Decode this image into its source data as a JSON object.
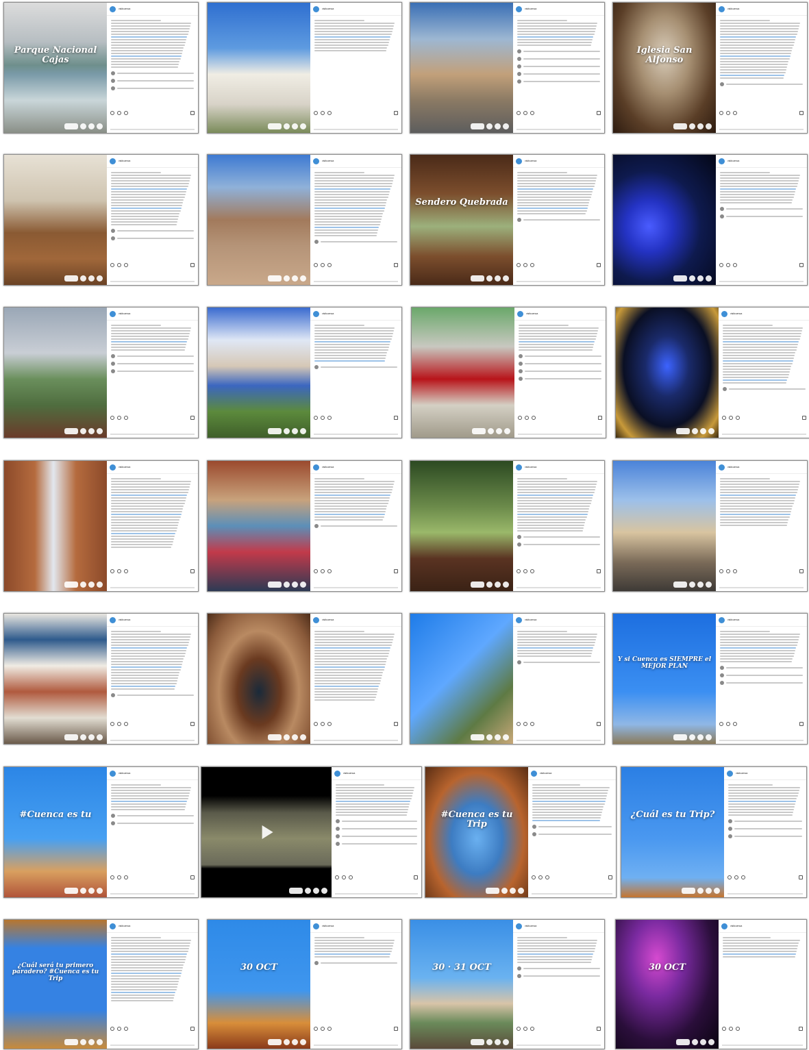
{
  "colors": {
    "page_background": "#ffffff",
    "card_border": "#8c8c8c",
    "avatar": "#3f8fd6"
  },
  "post_account": {
    "username": "visitcuenca"
  },
  "posts": [
    {
      "id": "r1c1",
      "caption": "Parque Nacional Cajas",
      "photo_bg": "linear-gradient(180deg,#dcdcdc 0%,#b7bec2 30%,#6e8f8c 48%,#7a9aa8 55%,#c9d6d9 75%,#8a8f87 100%)",
      "comments": 3,
      "lines": 18
    },
    {
      "id": "r1c2",
      "caption": "",
      "photo_bg": "linear-gradient(180deg,#2f6fd0 0%,#5e9be0 35%,#f0ede4 55%,#d8d3c8 78%,#7a8b5a 100%)",
      "comments": 0,
      "lines": 12
    },
    {
      "id": "r1c3",
      "caption": "",
      "photo_bg": "linear-gradient(180deg,#3a6fb5 0%,#9db7d2 28%,#c2a07a 55%,#8b7a64 75%,#5d5d5d 100%)",
      "comments": 5,
      "lines": 10
    },
    {
      "id": "r1c4",
      "caption": "Iglesia San Alfonso",
      "photo_bg": "radial-gradient(ellipse at 50% 40%,#d9cdbb 0%,#a68f72 35%,#5a3e27 70%,#2e1c10 100%)",
      "comments": 1,
      "lines": 22
    },
    {
      "id": "r2c1",
      "caption": "",
      "photo_bg": "linear-gradient(180deg,#e7e1d5 0%,#cfc4b0 35%,#8a5a33 60%,#a0673a 80%,#6b4325 100%)",
      "comments": 2,
      "lines": 20
    },
    {
      "id": "r2c2",
      "caption": "",
      "photo_bg": "linear-gradient(180deg,#3e7ad2 0%,#8fb1d9 25%,#a27a5c 50%,#b59478 70%,#c9a88a 100%)",
      "comments": 1,
      "lines": 24
    },
    {
      "id": "r2c3",
      "caption": "Sendero Quebrada",
      "photo_bg": "linear-gradient(180deg,#4a2a18 0%,#7c4e2d 30%,#9cb07c 55%,#7c4e2d 78%,#4a2a18 100%)",
      "comments": 1,
      "lines": 16
    },
    {
      "id": "r2c4",
      "caption": "",
      "photo_bg": "radial-gradient(ellipse at 35% 55%,#4a5cff 0%,#2433c4 25%,#0e1a4e 55%,#040716 100%)",
      "comments": 2,
      "lines": 12
    },
    {
      "id": "r3c1",
      "caption": "",
      "photo_bg": "linear-gradient(180deg,#9aa7b6 0%,#c9ced5 35%,#6a8f5c 55%,#4f6d3f 75%,#6a3b2a 100%)",
      "comments": 3,
      "lines": 10
    },
    {
      "id": "r3c2",
      "caption": "",
      "photo_bg": "linear-gradient(180deg,#3a6bcf 0%,#dfe7f5 25%,#d6c8b6 45%,#3b66c0 60%,#5c8a3c 80%,#3f5f2a 100%)",
      "comments": 1,
      "lines": 14
    },
    {
      "id": "r3c3",
      "caption": "",
      "photo_bg": "linear-gradient(180deg,#6aa86a 0%,#c8c8c0 30%,#b8141a 55%,#d4d0c4 75%,#a09a8a 100%)",
      "comments": 4,
      "lines": 10
    },
    {
      "id": "r3c4",
      "caption": "",
      "photo_bg": "radial-gradient(ellipse at 50% 45%,#3c63ff 0%,#1a2a6a 30%,#0a0f24 60%,#c89a3a 85%,#3b2a10 100%)",
      "comments": 1,
      "lines": 22
    },
    {
      "id": "r4c1",
      "caption": "",
      "photo_bg": "linear-gradient(90deg,#8c4a2a 0%,#b56b3e 30%,#e2e7ee 48%,#b56b3e 70%,#8c4a2a 100%)",
      "comments": 0,
      "lines": 26
    },
    {
      "id": "r4c2",
      "caption": "",
      "photo_bg": "linear-gradient(180deg,#9b4a2e 0%,#c8a27c 30%,#5c8fb8 50%,#c23a4a 70%,#2d3a54 100%)",
      "comments": 1,
      "lines": 16
    },
    {
      "id": "r4c3",
      "caption": "",
      "photo_bg": "linear-gradient(180deg,#2c4a22 0%,#6b8a4a 35%,#9ab86a 55%,#5a3322 75%,#3a2215 100%)",
      "comments": 2,
      "lines": 20
    },
    {
      "id": "r4c4",
      "caption": "",
      "photo_bg": "linear-gradient(180deg,#4b83d9 0%,#9cc0ea 30%,#d8c4a0 55%,#7a6a58 78%,#3e3a36 100%)",
      "comments": 0,
      "lines": 18
    },
    {
      "id": "r5c1",
      "caption": "",
      "photo_bg": "linear-gradient(180deg,#e9e6e0 0%,#2e5a8c 20%,#f0ece4 40%,#b05a3e 60%,#e2ddd2 80%,#6a5a4a 100%)",
      "comments": 1,
      "lines": 22
    },
    {
      "id": "r5c2",
      "caption": "",
      "photo_bg": "radial-gradient(ellipse at 50% 60%,#1a2a3a 0%,#6a3a20 30%,#b98a62 55%,#8a5a3a 80%,#4e2e1a 100%)",
      "comments": 0,
      "lines": 26
    },
    {
      "id": "r5c3",
      "caption": "",
      "photo_bg": "linear-gradient(135deg,#1f7ce8 0%,#5fa8ff 45%,#5e7a44 75%,#c8a878 100%)",
      "comments": 1,
      "lines": 10
    },
    {
      "id": "r5c4",
      "caption": "Y si Cuenca es SIEMPRE el MEJOR PLAN",
      "photo_bg": "linear-gradient(180deg,#1d6fe0 0%,#3b8ff2 60%,#8fb7e6 85%,#8a7a5a 100%)",
      "comments": 3,
      "lines": 12
    },
    {
      "id": "r6c1",
      "caption": "#Cuenca es tu",
      "photo_bg": "linear-gradient(180deg,#2c86e6 0%,#47a0f2 55%,#d9a060 80%,#b0543a 100%)",
      "comments": 2,
      "lines": 10
    },
    {
      "id": "r6c2",
      "caption": "",
      "photo_bg": "linear-gradient(180deg,#000 0%,#000 22%,#5a5a4a 35%,#8a8a6a 55%,#6a6a5a 75%,#000 78%,#000 100%)",
      "comments": 4,
      "lines": 12,
      "video": true
    },
    {
      "id": "r6c3",
      "caption": "#Cuenca es tu Trip",
      "photo_bg": "radial-gradient(ellipse at 50% 55%,#6ab0f0 0%,#3d7cc2 35%,#b8642e 65%,#5a2e14 100%)",
      "comments": 2,
      "lines": 14
    },
    {
      "id": "r6c4",
      "caption": "¿Cuál es tu Trip?",
      "photo_bg": "linear-gradient(180deg,#2b7fe4 0%,#4a98f0 55%,#6fb0f2 85%,#c6752e 100%)",
      "comments": 3,
      "lines": 12
    },
    {
      "id": "r7c1",
      "caption": "¿Cuál será tu primero paradero? #Cuenca es tu Trip",
      "photo_bg": "linear-gradient(180deg,#b8762e 0%,#3582e3 22%,#3582e3 70%,#c88a3a 100%)",
      "comments": 0,
      "lines": 24
    },
    {
      "id": "r7c2",
      "caption": "30 OCT",
      "photo_bg": "linear-gradient(180deg,#2e8ae8 0%,#3f96ee 55%,#d88e3a 80%,#8a3a1a 100%)",
      "comments": 1,
      "lines": 8
    },
    {
      "id": "r7c3",
      "caption": "30 · 31 OCT",
      "photo_bg": "linear-gradient(180deg,#3a8fe6 0%,#6ab2f0 45%,#d8c4a8 65%,#6a8a5a 80%,#5a4a3a 100%)",
      "comments": 2,
      "lines": 10
    },
    {
      "id": "r7c4",
      "caption": "30 OCT",
      "photo_bg": "radial-gradient(ellipse at 40% 30%,#d64ad0 0%,#7a2aa0 30%,#2a0e3a 65%,#0a0410 100%)",
      "comments": 0,
      "lines": 8
    }
  ]
}
